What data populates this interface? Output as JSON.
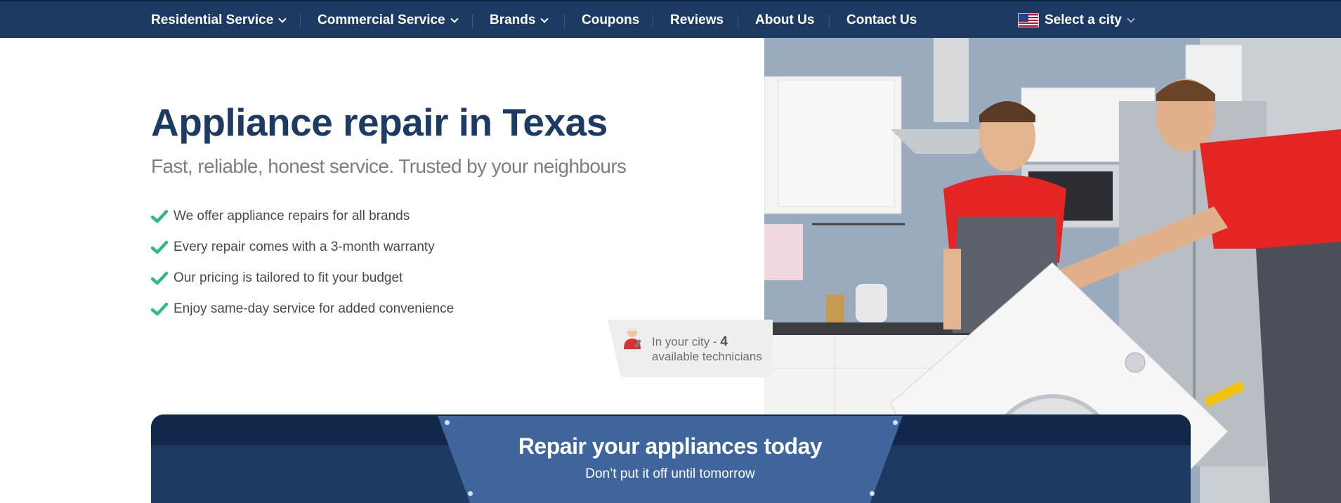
{
  "nav": {
    "items": [
      {
        "label": "Residential Service",
        "dropdown": true
      },
      {
        "label": "Commercial Service",
        "dropdown": true
      },
      {
        "label": "Brands",
        "dropdown": true
      },
      {
        "label": "Coupons",
        "dropdown": false
      },
      {
        "label": "Reviews",
        "dropdown": false
      },
      {
        "label": "About Us",
        "dropdown": false
      },
      {
        "label": "Contact Us",
        "dropdown": false
      }
    ],
    "city_select": {
      "label": "Select a city",
      "icon": "us-flag-icon"
    },
    "colors": {
      "background": "#1d3a63",
      "text": "#ffffff"
    }
  },
  "hero": {
    "title": "Appliance repair in Texas",
    "subtitle": "Fast, reliable, honest service. Trusted by your neighbours",
    "features": [
      "We offer appliance repairs for all brands",
      "Every repair comes with a 3-month warranty",
      "Our pricing is tailored to fit your budget",
      "Enjoy same-day service for added convenience"
    ],
    "check_icon": "check-icon",
    "check_color": "#2fb98a",
    "title_color": "#1d3a63"
  },
  "technicians": {
    "prefix": "In your city -",
    "count": "4",
    "suffix": "available technicians",
    "icon": "technician-avatar-icon"
  },
  "banner": {
    "title": "Repair your appliances today",
    "subtitle": "Don’t put it off until tomorrow",
    "colors": {
      "background": "#1d3a63",
      "plate": "#3f669c"
    }
  },
  "image": {
    "icon": "technicians-photo"
  }
}
